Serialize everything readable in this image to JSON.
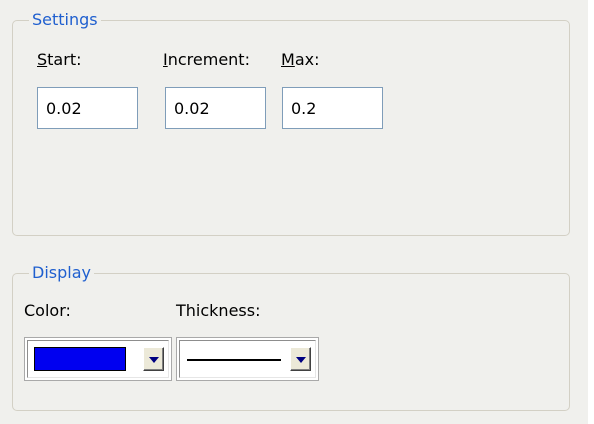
{
  "settings": {
    "title": "Settings",
    "start": {
      "label_hotkey": "S",
      "label_rest": "tart:",
      "value": "0.02"
    },
    "increment": {
      "label_hotkey": "I",
      "label_rest": "ncrement:",
      "value": "0.02"
    },
    "max": {
      "label_hotkey": "M",
      "label_rest": "ax:",
      "value": "0.2"
    }
  },
  "display": {
    "title": "Display",
    "color_label": "Color:",
    "thickness_label": "Thickness:",
    "color_value": "#0000f0",
    "thickness_value": "thin-line"
  },
  "icons": {
    "dropdown": "chevron-down-icon"
  }
}
